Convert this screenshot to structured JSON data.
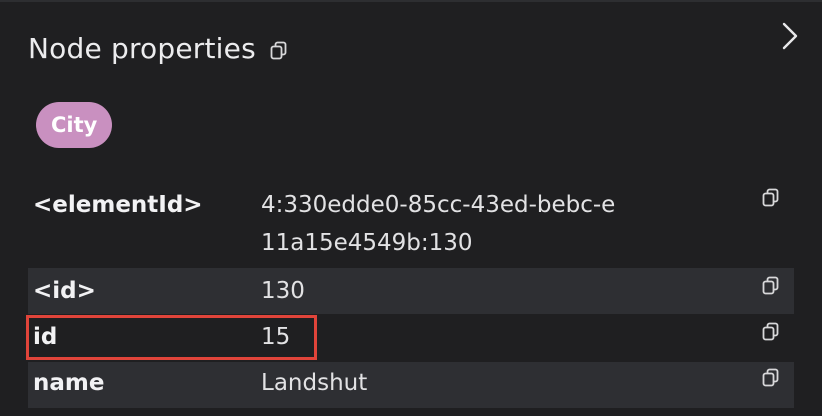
{
  "panel": {
    "title": "Node properties",
    "label_badge": "City"
  },
  "properties": [
    {
      "key": "<elementId>",
      "value": "4:330edde0-85cc-43ed-bebc-e11a15e4549b:130"
    },
    {
      "key": "<id>",
      "value": "130"
    },
    {
      "key": "id",
      "value": "15"
    },
    {
      "key": "name",
      "value": "Landshut"
    }
  ],
  "icons": {
    "title_copy": "copy-icon",
    "row_copy": "copy-icon",
    "collapse": "chevron-right-icon"
  },
  "colors": {
    "background": "#1f1f21",
    "stripe": "#2e2f33",
    "badge": "#c990c0",
    "highlight": "#e0443a"
  }
}
